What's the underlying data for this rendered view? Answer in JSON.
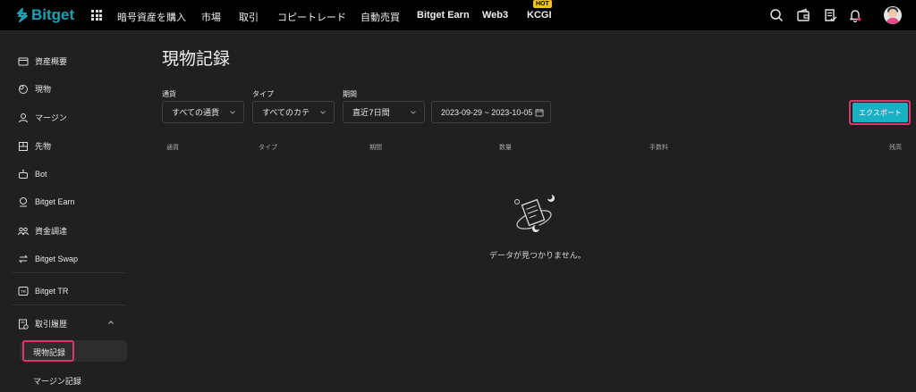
{
  "brand": {
    "name": "Bitget",
    "color": "#1da2b4"
  },
  "nav": {
    "items": [
      "暗号資産を購入",
      "市場",
      "取引",
      "コピートレード",
      "自動売買",
      "Bitget Earn",
      "Web3",
      "KCGI"
    ],
    "hot_badge": "HOT"
  },
  "header_icons": [
    "search-icon",
    "wallet-icon",
    "orders-icon",
    "bell-icon",
    "avatar"
  ],
  "sidebar": {
    "items": [
      {
        "label": "資産概要",
        "icon": "assets-icon"
      },
      {
        "label": "現物",
        "icon": "spot-icon"
      },
      {
        "label": "マージン",
        "icon": "margin-icon"
      },
      {
        "label": "先物",
        "icon": "futures-icon"
      },
      {
        "label": "Bot",
        "icon": "bot-icon"
      },
      {
        "label": "Bitget Earn",
        "icon": "earn-icon"
      },
      {
        "label": "資金調達",
        "icon": "funding-icon"
      },
      {
        "label": "Bitget Swap",
        "icon": "swap-icon"
      },
      {
        "label": "Bitget TR",
        "icon": "tr-icon"
      },
      {
        "label": "取引履歴",
        "icon": "history-icon"
      }
    ],
    "sub_items": [
      "現物記録",
      "マージン記録"
    ]
  },
  "main": {
    "title": "現物記録",
    "filters": {
      "currency_label": "通貨",
      "currency_value": "すべての通貨",
      "type_label": "タイプ",
      "type_value": "すべてのカテ",
      "period_label": "期間",
      "period_value": "直近7日間",
      "date_range": "2023-09-29 ~ 2023-10-05"
    },
    "export_label": "エクスポート",
    "table_headers": [
      "通貨",
      "タイプ",
      "期間",
      "数量",
      "手数料",
      "残高"
    ],
    "empty_text": "データが見つかりません。"
  },
  "colors": {
    "accent": "#1ab0c4",
    "highlight": "#e0336e",
    "hot": "#f0c02a"
  }
}
